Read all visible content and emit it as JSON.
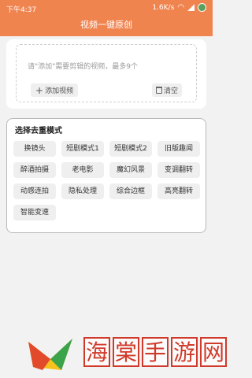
{
  "status_bar": {
    "time": "下午4:37",
    "speed": "1.6K/s"
  },
  "header": {
    "title": "视频一键原创"
  },
  "upload": {
    "hint": "请\"添加\"需要剪辑的视频，最多9个",
    "add_label": "添加视频",
    "clear_label": "清空"
  },
  "modes": {
    "title": "选择去重模式",
    "items": [
      "换镜头",
      "短剧模式1",
      "短剧模式2",
      "旧版趣闻",
      "醉酒拍摄",
      "老电影",
      "魔幻风景",
      "变调翻转",
      "动感连拍",
      "隐私处理",
      "综合边框",
      "高亮翻转",
      "智能变速"
    ]
  },
  "watermark": {
    "text": "海棠手游网"
  }
}
